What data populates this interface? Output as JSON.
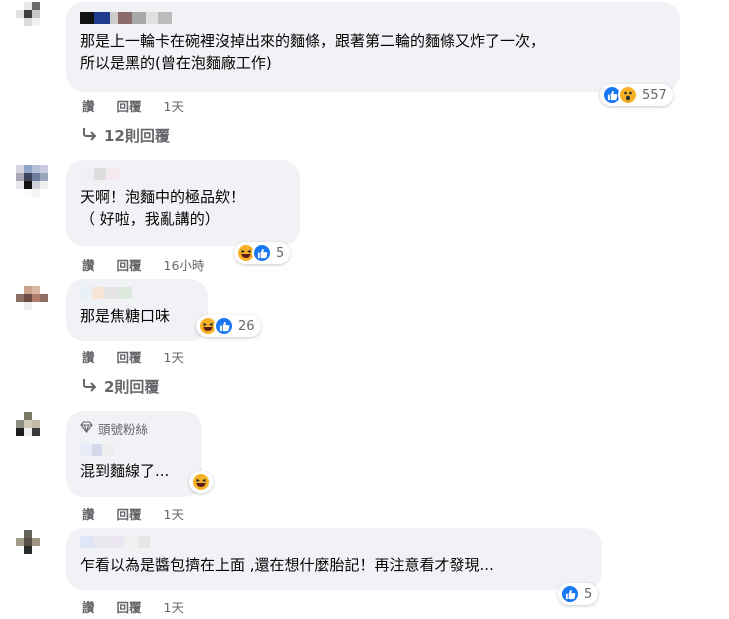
{
  "comments": [
    {
      "text": "那是上一輪卡在碗裡沒掉出來的麵條，跟著第二輪的麵條又炸了一次，\n所以是黑的(曾在泡麵廠工作)",
      "actions": [
        "讚",
        "回覆"
      ],
      "time": "1天",
      "reaction_count": "557",
      "reactions": [
        "like-icon",
        "wow-icon"
      ],
      "replies": "12則回覆"
    },
    {
      "text": "天啊！泡麵中的極品欸！\n（ 好啦，我亂講的）",
      "actions": [
        "讚",
        "回覆"
      ],
      "time": "16小時",
      "reaction_count": "5",
      "reactions": [
        "haha-icon",
        "like-icon"
      ]
    },
    {
      "text": "那是焦糖口味",
      "actions": [
        "讚",
        "回覆"
      ],
      "time": "1天",
      "reaction_count": "26",
      "reactions": [
        "haha-icon",
        "like-icon"
      ],
      "replies": "2則回覆"
    },
    {
      "badge": "頭號粉絲",
      "text": "混到麵線了...",
      "actions": [
        "讚",
        "回覆"
      ],
      "time": "1天",
      "reactions": [
        "haha-icon"
      ]
    },
    {
      "text": "乍看以為是醬包擠在上面 ,還在想什麼胎記！再注意看才發現...",
      "actions": [
        "讚",
        "回覆"
      ],
      "time": "1天",
      "reaction_count": "5",
      "reactions": [
        "like-icon"
      ]
    }
  ],
  "colors": {
    "bubble": "#f0f2f5",
    "like": "#1877f2",
    "haha": "#f7b125",
    "meta": "#65676b"
  }
}
